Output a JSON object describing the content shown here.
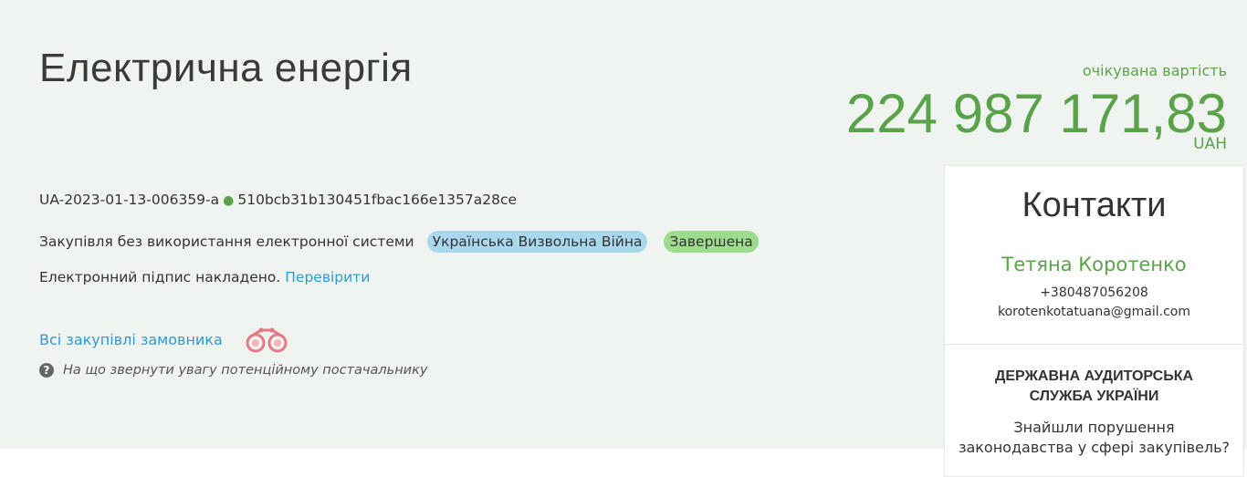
{
  "tender": {
    "title": "Електрична енергія",
    "cost_label": "очікувана вартість",
    "cost_value": "224 987 171,83",
    "currency": "UAH",
    "tender_id": "UA-2023-01-13-006359-a",
    "hash": "510bcb31b130451fbac166e1357a28ce",
    "procedure": "Закупівля без використання електронної системи",
    "badge_war": "Українська Визвольна Війна",
    "badge_status": "Завершена",
    "signature_text": "Електронний підпис накладено.",
    "signature_link": "Перевірити",
    "all_purchases_link": "Всі закупівлі замовника",
    "hint_text": "На що звернути увагу потенційному постачальнику"
  },
  "contacts": {
    "title": "Контакти",
    "name": "Тетяна Коротенко",
    "phone": "+380487056208",
    "email": "korotenkotatuana@gmail.com"
  },
  "audit": {
    "title_line1": "ДЕРЖАВНА АУДИТОРСЬКА",
    "title_line2": "СЛУЖБА УКРАЇНИ",
    "text_line1": "Знайшли порушення",
    "text_line2": "законодавства у сфері закупівель?"
  },
  "colors": {
    "accent_green": "#5aa34a",
    "link_blue": "#2e9ad0",
    "badge_blue": "#a9d8ee",
    "badge_green": "#9ddb8f",
    "hero_bg": "#f0f4f0"
  },
  "icons": {
    "binoculars": "binoculars-icon",
    "question": "question-circle-icon"
  }
}
